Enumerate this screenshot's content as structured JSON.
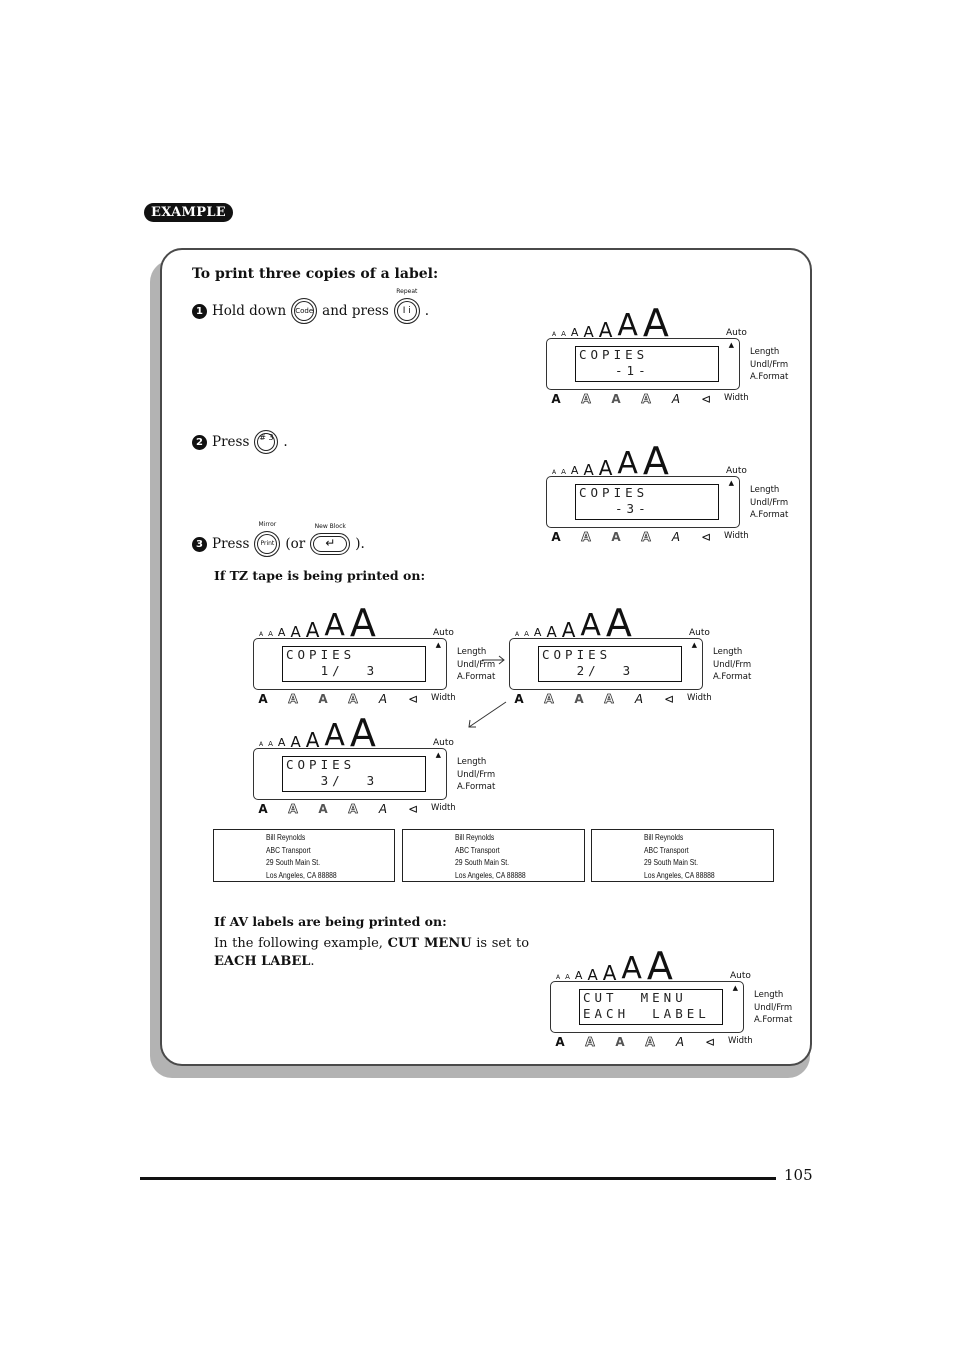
{
  "badge": "EXAMPLE",
  "heading": "To print three copies of a label:",
  "steps": [
    {
      "num": "1",
      "text_a": "Hold down",
      "key1": {
        "label": "Code",
        "icon": "code-key"
      },
      "text_b": "and press",
      "key2": {
        "label": "I i",
        "caption": "Repeat",
        "icon": "repeat-key"
      },
      "text_c": "."
    },
    {
      "num": "2",
      "text_a": "Press",
      "key1": {
        "label": "# 3",
        "icon": "3-key"
      },
      "text_c": "."
    },
    {
      "num": "3",
      "text_a": "Press",
      "key1": {
        "label": "Print",
        "caption": "Mirror",
        "icon": "print-key"
      },
      "text_b": "(or",
      "key2": {
        "label": "↵",
        "caption": "New Block",
        "icon": "new-block-enter-key"
      },
      "text_c": ")."
    }
  ],
  "lcd_common": {
    "sizes": [
      "A",
      "A",
      "A",
      "A",
      "A",
      "A",
      "A"
    ],
    "auto": "Auto",
    "indicator": "▲",
    "side": [
      "Length",
      "Undl/Frm",
      "A.Format"
    ],
    "icons": [
      "A",
      "A",
      "A",
      "A",
      "A",
      "⊲"
    ],
    "width": "Width"
  },
  "displays": {
    "step1": {
      "line1": "COPIES",
      "line2": "1"
    },
    "step2": {
      "line1": "COPIES",
      "line2": "3"
    },
    "tz1": {
      "line1": "COPIES",
      "line2": "   1/  3"
    },
    "tz2": {
      "line1": "COPIES",
      "line2": "   2/  3"
    },
    "tz3": {
      "line1": "COPIES",
      "line2": "   3/  3"
    },
    "av": {
      "line1": "CUT  MENU",
      "line2": "EACH  LABEL"
    }
  },
  "tz_heading": "If TZ tape is being printed on:",
  "labels": [
    {
      "lines": [
        "Bill Reynolds",
        "ABC Transport",
        "29 South Main St.",
        "Los Angeles, CA 88888"
      ]
    },
    {
      "lines": [
        "Bill Reynolds",
        "ABC Transport",
        "29 South Main St.",
        "Los Angeles, CA 88888"
      ]
    },
    {
      "lines": [
        "Bill Reynolds",
        "ABC Transport",
        "29 South Main St.",
        "Los Angeles, CA 88888"
      ]
    }
  ],
  "av_heading": "If AV labels are being printed on:",
  "av_para": {
    "a": "In the following example,",
    "b": "CUT MENU",
    "c": "is set to",
    "d": "EACH LABEL",
    "e": "."
  },
  "page_number": "105"
}
